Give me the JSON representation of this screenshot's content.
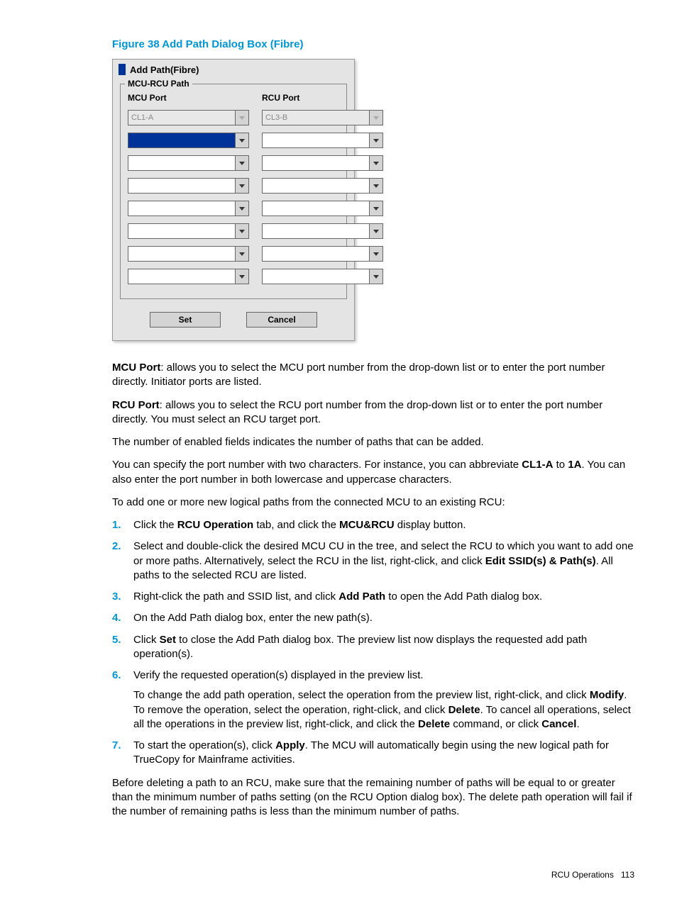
{
  "figure_caption": "Figure 38 Add Path Dialog Box (Fibre)",
  "dialog": {
    "title": "Add Path(Fibre)",
    "legend": "MCU-RCU Path",
    "mcu_header": "MCU Port",
    "rcu_header": "RCU Port",
    "mcu_values": [
      "CL1-A",
      "",
      "",
      "",
      "",
      "",
      "",
      ""
    ],
    "rcu_values": [
      "CL3-B",
      "",
      "",
      "",
      "",
      "",
      "",
      ""
    ],
    "set_btn": "Set",
    "cancel_btn": "Cancel"
  },
  "paragraphs": {
    "mcu_port_label": "MCU Port",
    "mcu_port_text": ": allows you to select the MCU port number from the drop-down list or to enter the port number directly. Initiator ports are listed.",
    "rcu_port_label": "RCU Port",
    "rcu_port_text": ": allows you to select the RCU port number from the drop-down list or to enter the port number directly. You must select an RCU target port.",
    "p3": "The number of enabled fields indicates the number of paths that can be added.",
    "p4a": "You can specify the port number with two characters. For instance, you can abbreviate ",
    "p4_cl1a": "CL1-A",
    "p4b": " to ",
    "p4_1a": "1A",
    "p4c": ". You can also enter the port number in both lowercase and uppercase characters.",
    "p5": "To add one or more new logical paths from the connected MCU to an existing RCU:"
  },
  "steps": [
    {
      "num": "1.",
      "parts": [
        "Click the ",
        "RCU Operation",
        " tab, and click the ",
        "MCU&RCU",
        " display button."
      ]
    },
    {
      "num": "2.",
      "parts": [
        "Select and double-click the desired MCU CU in the tree, and select the RCU to which you want to add one or more paths. Alternatively, select the RCU in the list, right-click, and click ",
        "Edit SSID(s) & Path(s)",
        ". All paths to the selected RCU are listed."
      ]
    },
    {
      "num": "3.",
      "parts": [
        "Right-click the path and SSID list, and click ",
        "Add Path",
        " to open the Add Path dialog box."
      ]
    },
    {
      "num": "4.",
      "parts": [
        "On the Add Path dialog box, enter the new path(s)."
      ]
    },
    {
      "num": "5.",
      "parts": [
        "Click ",
        "Set",
        " to close the Add Path dialog box. The preview list now displays the requested add path operation(s)."
      ]
    },
    {
      "num": "6.",
      "parts": [
        "Verify the requested operation(s) displayed in the preview list."
      ],
      "extra": [
        "To change the add path operation, select the operation from the preview list, right-click, and click ",
        "Modify",
        ". To remove the operation, select the operation, right-click, and click ",
        "Delete",
        ". To cancel all operations, select all the operations in the preview list, right-click, and click the ",
        "Delete",
        " command, or click ",
        "Cancel",
        "."
      ]
    },
    {
      "num": "7.",
      "parts": [
        "To start the operation(s), click ",
        "Apply",
        ". The MCU will automatically begin using the new logical path for TrueCopy for Mainframe activities."
      ]
    }
  ],
  "closing": "Before deleting a path to an RCU, make sure that the remaining number of paths will be equal to or greater than the minimum number of paths setting (on the RCU Option dialog box). The delete path operation will fail if the number of remaining paths is less than the minimum number of paths.",
  "footer_section": "RCU Operations",
  "footer_page": "113"
}
